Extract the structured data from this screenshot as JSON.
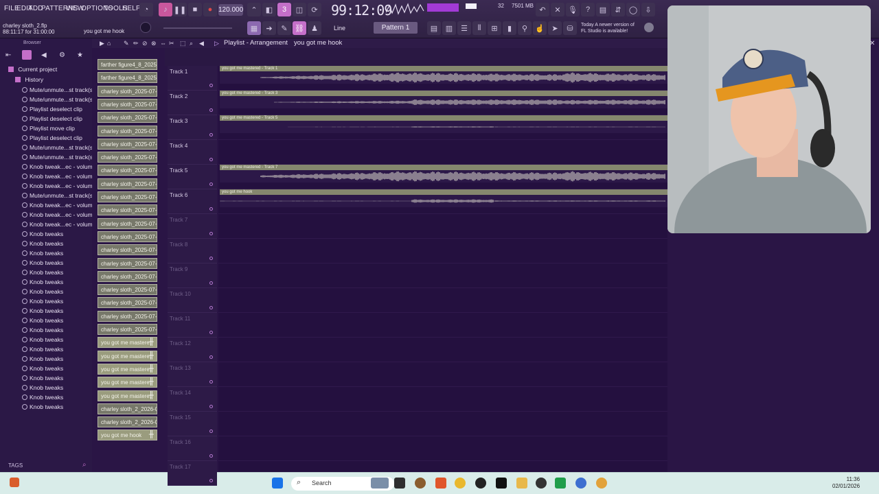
{
  "menu": [
    "FILE",
    "EDIT",
    "ADD",
    "PATTERNS",
    "VIEW",
    "OPTIONS",
    "TOOLS",
    "HELP"
  ],
  "tempo": "120.000",
  "time_display": "99:12:09",
  "memory": "7501 MB",
  "cpu_count": "32",
  "project_file": "charley sloth_2.flp",
  "project_time": "88:11:17 for 31:00:00",
  "hint_text": "you got me  hook",
  "snap_label": "Line",
  "pattern_label": "Pattern 1",
  "news": {
    "line1": "Today  A newer version of",
    "line2": "FL Studio is available!"
  },
  "browser": {
    "header": "Browser",
    "root": "Current project",
    "history_label": "History",
    "history_items": [
      "Mute/unmute...st track(s)",
      "Mute/unmute...st track(s)",
      "Playlist deselect clip",
      "Playlist deselect clip",
      "Playlist move clip",
      "Playlist deselect clip",
      "Mute/unmute...st track(s)",
      "Mute/unmute...st track(s)",
      "Knob tweak...ec - volume",
      "Knob tweak...ec - volume",
      "Knob tweak...ec - volume",
      "Mute/unmute...st track(s)",
      "Knob tweak...ec - volume",
      "Knob tweak...ec - volume",
      "Knob tweak...ec - volume",
      "Knob tweaks",
      "Knob tweaks",
      "Knob tweaks",
      "Knob tweaks",
      "Knob tweaks",
      "Knob tweaks",
      "Knob tweaks",
      "Knob tweaks",
      "Knob tweaks",
      "Knob tweaks",
      "Knob tweaks",
      "Knob tweaks",
      "Knob tweaks",
      "Knob tweaks",
      "Knob tweaks",
      "Knob tweaks",
      "Knob tweaks",
      "Knob tweaks",
      "Knob tweaks"
    ],
    "tags_label": "TAGS"
  },
  "playlist": {
    "title": "Playlist - Arrangement",
    "clip_name": "you got me  hook"
  },
  "clips": [
    "farther figure4_8_2025-",
    "farther figure4_8_2025-",
    "charley sloth_2025-07-1..",
    "charley sloth_2025-07-1..",
    "charley sloth_2025-07-1..",
    "charley sloth_2025-07-1..",
    "charley sloth_2025-07-1..",
    "charley sloth_2025-07-1..",
    "charley sloth_2025-07-1..",
    "charley sloth_2025-07-1..",
    "charley sloth_2025-07-1..",
    "charley sloth_2025-07-1..",
    "charley sloth_2025-07-1..",
    "charley sloth_2025-07-1..",
    "charley sloth_2025-07-1..",
    "charley sloth_2025-07-1..",
    "charley sloth_2025-07-1..",
    "charley sloth_2025-07-1..",
    "charley sloth_2025-07-1..",
    "charley sloth_2025-07-1..",
    "charley sloth_2025-07-1..",
    "you got me  mastere..",
    "you got me  mastere..",
    "you got me  mastere..",
    "you got me  mastere..",
    "you got me  mastere..",
    "charley sloth_2_2026-01..",
    "charley sloth_2_2026-01..",
    "you got me  hook"
  ],
  "tracks": [
    "Track 1",
    "Track 2",
    "Track 3",
    "Track 4",
    "Track 5",
    "Track 6",
    "Track 7",
    "Track 8",
    "Track 9",
    "Track 10",
    "Track 11",
    "Track 12",
    "Track 13",
    "Track 14",
    "Track 15",
    "Track 16",
    "Track 17"
  ],
  "audio_clips": [
    {
      "label": "you got me  mastered - Track 1"
    },
    {
      "label": "you got me  mastered - Track 3"
    },
    {
      "label": "you got me  mastered - Track 5"
    },
    {
      "label": ""
    },
    {
      "label": "you got me  mastered - Track 7"
    },
    {
      "label": "you got me  hook"
    }
  ],
  "taskbar": {
    "search": "Search",
    "time": "11:36",
    "date": "02/01/2026"
  },
  "colors": {
    "accent": "#c46fc9",
    "clip": "#85876e",
    "cpu": "#a23ad6"
  }
}
